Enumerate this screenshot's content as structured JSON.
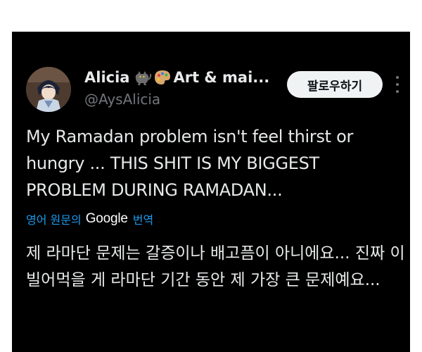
{
  "tweet": {
    "author": {
      "display_name_start": "Alicia",
      "display_name_end": "Art & mai...",
      "name_emojis": [
        "cat-emoji",
        "palette-emoji"
      ],
      "handle": "@AysAlicia",
      "avatar": "anime-character-avatar"
    },
    "follow_button_label": "팔로우하기",
    "more_icon": "more-vertical-icon",
    "text": "My Ramadan problem isn't feel thirst or hungry ... THIS SHIT IS MY BIGGEST PROBLEM DURING RAMADAN...",
    "translation": {
      "prefix": "영어 원문의",
      "provider": "Google",
      "suffix": "번역",
      "text": "제 라마단 문제는 갈증이나 배고픔이 아니에요... 진짜 이 빌어먹을 게 라마단 기간 동안 제 가장 큰 문제예요..."
    }
  },
  "colors": {
    "card_background": "#000000",
    "page_background": "#ffffff",
    "primary_text": "#e7e9ea",
    "secondary_text": "#71767b",
    "link_blue": "#1d9bf0",
    "button_background": "#eff3f4"
  }
}
